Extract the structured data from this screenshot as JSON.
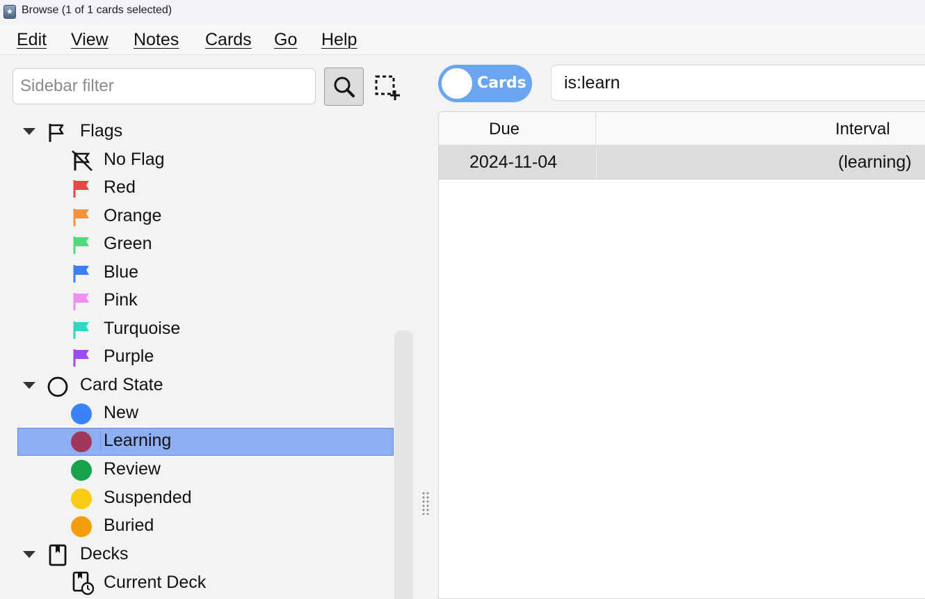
{
  "window": {
    "title": "Browse (1 of 1 cards selected)"
  },
  "menu": [
    "Edit",
    "View",
    "Notes",
    "Cards",
    "Go",
    "Help"
  ],
  "sidebar": {
    "filter_placeholder": "Sidebar filter",
    "flags": {
      "label": "Flags",
      "items": [
        {
          "label": "No Flag",
          "color": "#222222"
        },
        {
          "label": "Red",
          "color": "#e84545"
        },
        {
          "label": "Orange",
          "color": "#f5923e"
        },
        {
          "label": "Green",
          "color": "#4fdc7c"
        },
        {
          "label": "Blue",
          "color": "#3b7ff0"
        },
        {
          "label": "Pink",
          "color": "#ef8ef0"
        },
        {
          "label": "Turquoise",
          "color": "#33d6c2"
        },
        {
          "label": "Purple",
          "color": "#9c4cf1"
        }
      ]
    },
    "card_state": {
      "label": "Card State",
      "items": [
        {
          "label": "New",
          "color": "#3b82f6"
        },
        {
          "label": "Learning",
          "color": "#a3365d"
        },
        {
          "label": "Review",
          "color": "#16a34a"
        },
        {
          "label": "Suspended",
          "color": "#facc15"
        },
        {
          "label": "Buried",
          "color": "#f59e0b"
        }
      ]
    },
    "decks": {
      "label": "Decks",
      "items": [
        {
          "label": "Current Deck"
        }
      ]
    }
  },
  "toolbar": {
    "toggle_label": "Cards",
    "search_value": "is:learn"
  },
  "table": {
    "columns": [
      "Due",
      "Interval"
    ],
    "rows": [
      {
        "due": "2024-11-04",
        "interval": "(learning)"
      }
    ]
  }
}
